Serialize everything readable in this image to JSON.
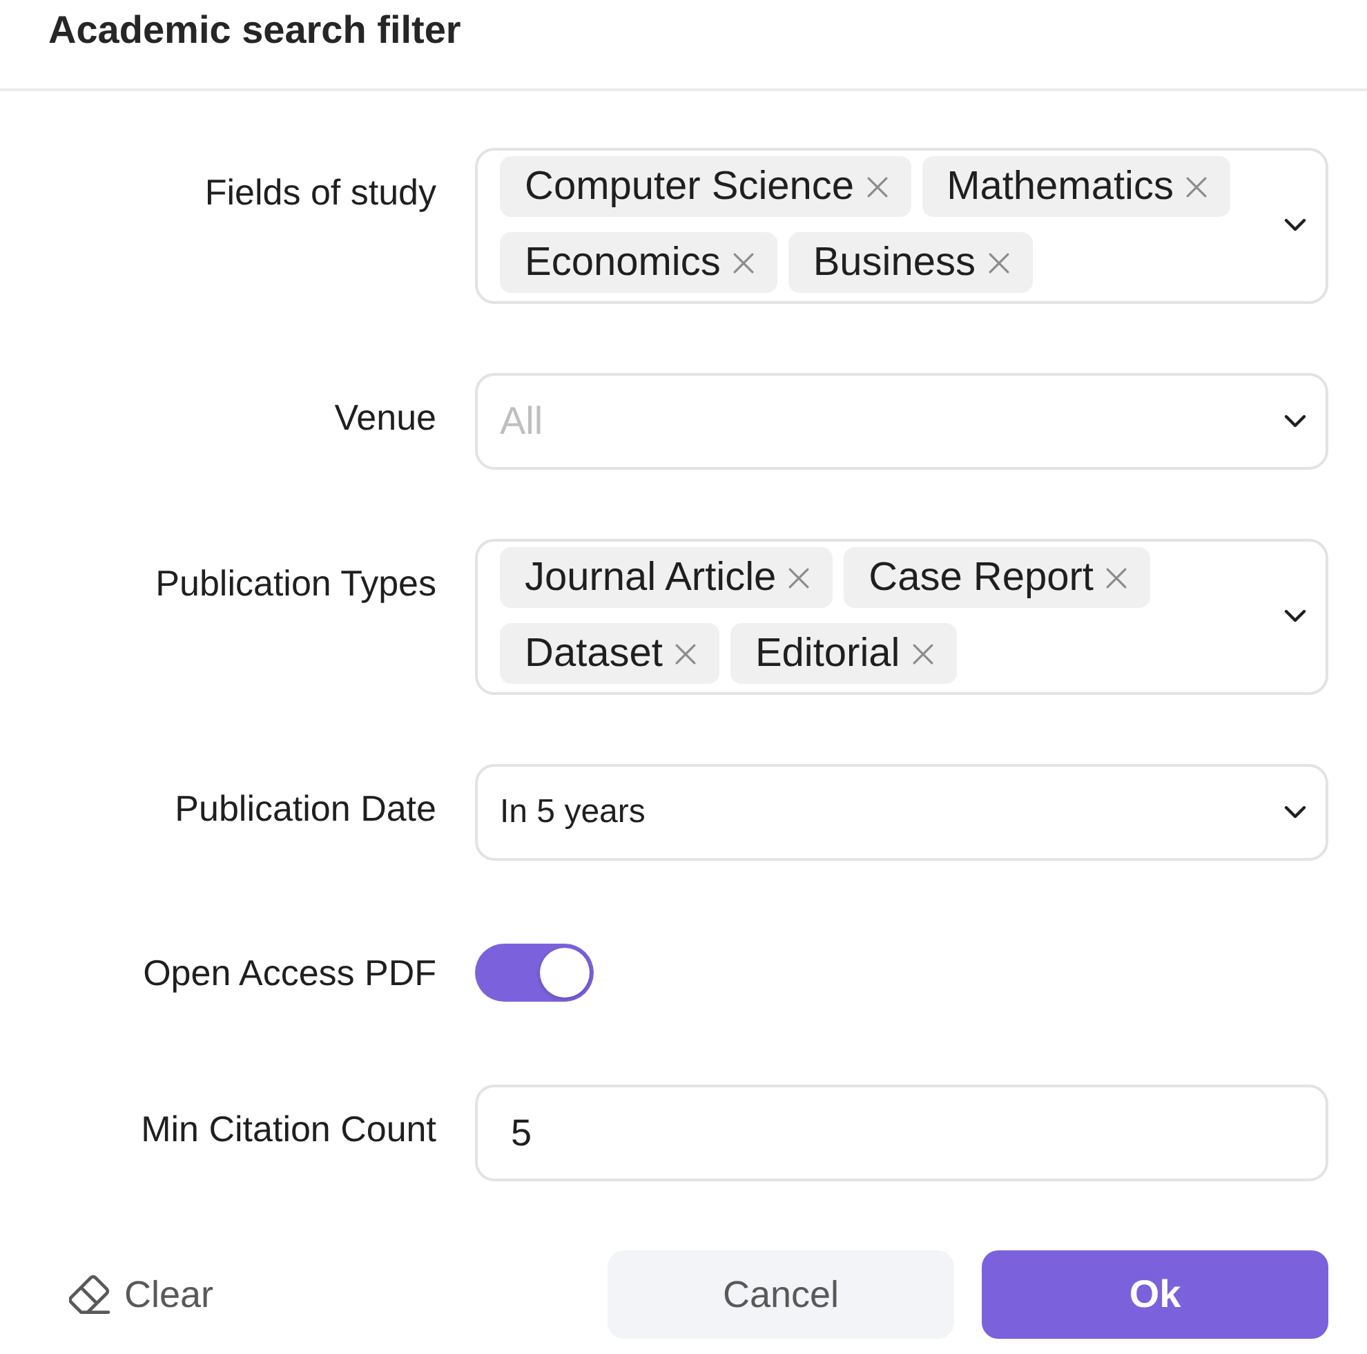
{
  "dialog": {
    "title": "Academic search filter"
  },
  "fields": [
    {
      "kind": "tags",
      "label": "Fields of study",
      "tags": [
        "Computer Science",
        "Mathematics",
        "Economics",
        "Business"
      ]
    },
    {
      "kind": "select",
      "label": "Venue",
      "placeholder": "All"
    },
    {
      "kind": "tags",
      "label": "Publication Types",
      "tags": [
        "Journal Article",
        "Case Report",
        "Dataset",
        "Editorial"
      ]
    },
    {
      "kind": "select",
      "label": "Publication Date",
      "value": "In 5 years"
    },
    {
      "kind": "switch",
      "label": "Open Access PDF",
      "on": true
    },
    {
      "kind": "number",
      "label": "Min Citation Count",
      "value": "5"
    }
  ],
  "footer": {
    "clear": "Clear",
    "buttons": [
      {
        "kind": "cancel",
        "label": "Cancel"
      },
      {
        "kind": "ok",
        "label": "Ok"
      }
    ]
  }
}
